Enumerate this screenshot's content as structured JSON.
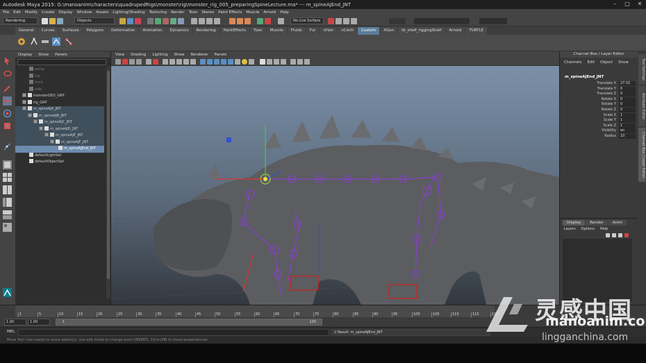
{
  "titlebar": {
    "title": "Autodesk Maya 2015: G:\\manoanim\\characters\\quadrupedRigs\\monster\\rig\\monster_rig_005_preparingSpineLecture.ma* --- m_spineAJEnd_JNT",
    "minimize": "–",
    "maximize": "□",
    "close": "✕"
  },
  "menubar": [
    "File",
    "Edit",
    "Modify",
    "Create",
    "Display",
    "Window",
    "Assets",
    "Lighting/Shading",
    "Texturing",
    "Render",
    "Toon",
    "Stereo",
    "Paint Effects",
    "Muscle",
    "Arnold",
    "Help"
  ],
  "statusline": {
    "mode": "Rendering",
    "selection_field": "Objects",
    "surface_field": "No Live Surface"
  },
  "shelf": {
    "tabs": [
      "General",
      "Curves",
      "Surfaces",
      "Polygons",
      "Deformation",
      "Animation",
      "Dynamics",
      "Rendering",
      "PaintEffects",
      "Toon",
      "Muscle",
      "Fluids",
      "Fur",
      "nHair",
      "nCloth",
      "Custom",
      "XGen",
      "tb_shelf_riggingShelf",
      "Arnold",
      "TURTLE"
    ],
    "active_tab": "Custom"
  },
  "outliner": {
    "menu": [
      "Display",
      "Show",
      "Panels"
    ],
    "items": [
      {
        "label": "persp",
        "dim": true
      },
      {
        "label": "top",
        "dim": true
      },
      {
        "label": "front",
        "dim": true
      },
      {
        "label": "side",
        "dim": true
      },
      {
        "label": "monsterGEO_GRP",
        "dim": false
      },
      {
        "label": "rig_GRP",
        "dim": false
      },
      {
        "label": "m_spineAJA_JNT",
        "dim": false
      },
      {
        "label": "m_spineAJB_JNT",
        "dim": false
      },
      {
        "label": "m_spineAJC_JNT",
        "dim": false
      },
      {
        "label": "m_spineAJD_JNT",
        "dim": false
      },
      {
        "label": "m_spineAJE_JNT",
        "dim": false
      },
      {
        "label": "m_spineAJF_JNT",
        "dim": false
      },
      {
        "label": "m_spineAJEnd_JNT",
        "dim": false
      },
      {
        "label": "defaultLightSet",
        "dim": false
      },
      {
        "label": "defaultObjectSet",
        "dim": false
      }
    ]
  },
  "viewport": {
    "menu": [
      "View",
      "Shading",
      "Lighting",
      "Show",
      "Renderer",
      "Panels"
    ]
  },
  "channelbox": {
    "title": "Channel Box / Layer Editor",
    "menu": [
      "Channels",
      "Edit",
      "Object",
      "Show"
    ],
    "object_name": "m_spineAJEnd_JNT",
    "attributes": [
      {
        "label": "Translate X",
        "value": "27.02"
      },
      {
        "label": "Translate Y",
        "value": "0"
      },
      {
        "label": "Translate Z",
        "value": "0"
      },
      {
        "label": "Rotate X",
        "value": "0"
      },
      {
        "label": "Rotate Y",
        "value": "0"
      },
      {
        "label": "Rotate Z",
        "value": "0"
      },
      {
        "label": "Scale X",
        "value": "1"
      },
      {
        "label": "Scale Y",
        "value": "1"
      },
      {
        "label": "Scale Z",
        "value": "1"
      },
      {
        "label": "Visibility",
        "value": "on"
      },
      {
        "label": "Radius",
        "value": "10"
      }
    ],
    "layer_tabs": [
      "Display",
      "Render",
      "Anim"
    ],
    "layer_menu": [
      "Layers",
      "Options",
      "Help"
    ]
  },
  "sidetabs": [
    "Tool Settings",
    "Attribute Editor",
    "Channel Box / Layer Editor"
  ],
  "timeslider": {
    "ticks": [
      "1",
      "5",
      "10",
      "15",
      "20",
      "25",
      "30",
      "35",
      "40",
      "45",
      "50",
      "55",
      "60",
      "65",
      "70",
      "75",
      "80",
      "85",
      "90",
      "95",
      "100",
      "105",
      "110",
      "115",
      "120"
    ]
  },
  "rangeslider": {
    "start": "1.00",
    "playback_start": "1.00",
    "bar_start": "1",
    "bar_end": "120"
  },
  "cmdline": {
    "label": "MEL",
    "result": "// Result: m_spineAJEnd_JNT"
  },
  "helpline": "Move Tool: Use manip to move object(s). Use edit mode to change pivot (INSERT). Ctrl+LMB to move perpendicular.",
  "watermark": {
    "cn": "灵感中国",
    "site": "manoanim.com",
    "sub": "lingganchina.com"
  },
  "colors": {
    "accent": "#5d7d99",
    "selection": "#6d8bae",
    "viewport_top": "#7b90a8",
    "viewport_bottom": "#33383e"
  }
}
